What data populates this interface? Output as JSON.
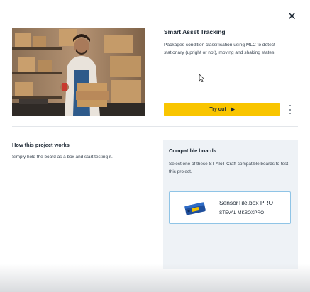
{
  "card": {
    "title": "Smart Asset Tracking",
    "description": "Packages condition classification using MLC to detect stationary (upright or not), moving and shaking states.",
    "try_out_label": "Try out"
  },
  "how_it_works": {
    "title": "How this project works",
    "text": "Simply hold the board as a box and start testing it."
  },
  "compatible": {
    "title": "Compatible boards",
    "text": "Select one of these ST AIoT Craft compatible boards to test this project.",
    "boards": [
      {
        "name": "SensorTile.box PRO",
        "code": "STEVAL-MKBOXPRO"
      }
    ]
  },
  "icons": {
    "close": "close-icon",
    "play": "play-icon",
    "more": "more-vertical-icon"
  },
  "colors": {
    "accent": "#f9c500",
    "panel_bg": "#eef2f6",
    "board_border": "#8fc4e6"
  }
}
